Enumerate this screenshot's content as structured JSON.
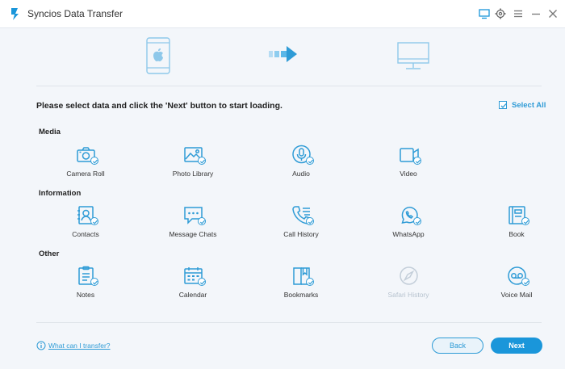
{
  "window": {
    "title": "Syncios Data Transfer"
  },
  "titlebar_icons": [
    "screen-icon",
    "gear-icon",
    "menu-icon",
    "minimize-icon",
    "close-icon"
  ],
  "instruction": "Please select data and click the 'Next' button to start loading.",
  "select_all": {
    "label": "Select All",
    "checked": true
  },
  "sections": [
    {
      "title": "Media",
      "items": [
        {
          "label": "Camera Roll",
          "icon": "camera-icon",
          "checked": true
        },
        {
          "label": "Photo Library",
          "icon": "photo-icon",
          "checked": true
        },
        {
          "label": "Audio",
          "icon": "microphone-icon",
          "checked": true
        },
        {
          "label": "Video",
          "icon": "video-camera-icon",
          "checked": true
        }
      ]
    },
    {
      "title": "Information",
      "items": [
        {
          "label": "Contacts",
          "icon": "contacts-icon",
          "checked": true
        },
        {
          "label": "Message Chats",
          "icon": "chat-bubble-icon",
          "checked": true
        },
        {
          "label": "Call History",
          "icon": "phone-icon",
          "checked": true
        },
        {
          "label": "WhatsApp",
          "icon": "whatsapp-icon",
          "checked": true
        },
        {
          "label": "Book",
          "icon": "book-icon",
          "checked": true
        }
      ]
    },
    {
      "title": "Other",
      "items": [
        {
          "label": "Notes",
          "icon": "notes-icon",
          "checked": true
        },
        {
          "label": "Calendar",
          "icon": "calendar-icon",
          "checked": true
        },
        {
          "label": "Bookmarks",
          "icon": "bookmark-icon",
          "checked": true
        },
        {
          "label": "Safari History",
          "icon": "compass-icon",
          "checked": false,
          "disabled": true
        },
        {
          "label": "Voice Mail",
          "icon": "voicemail-icon",
          "checked": true
        }
      ]
    }
  ],
  "footer": {
    "help_link": "What can I transfer?",
    "back_label": "Back",
    "next_label": "Next"
  },
  "colors": {
    "accent": "#1a96da",
    "icon": "#2e9bd6",
    "disabled": "#b7c3cf",
    "background": "#f3f6fa"
  }
}
